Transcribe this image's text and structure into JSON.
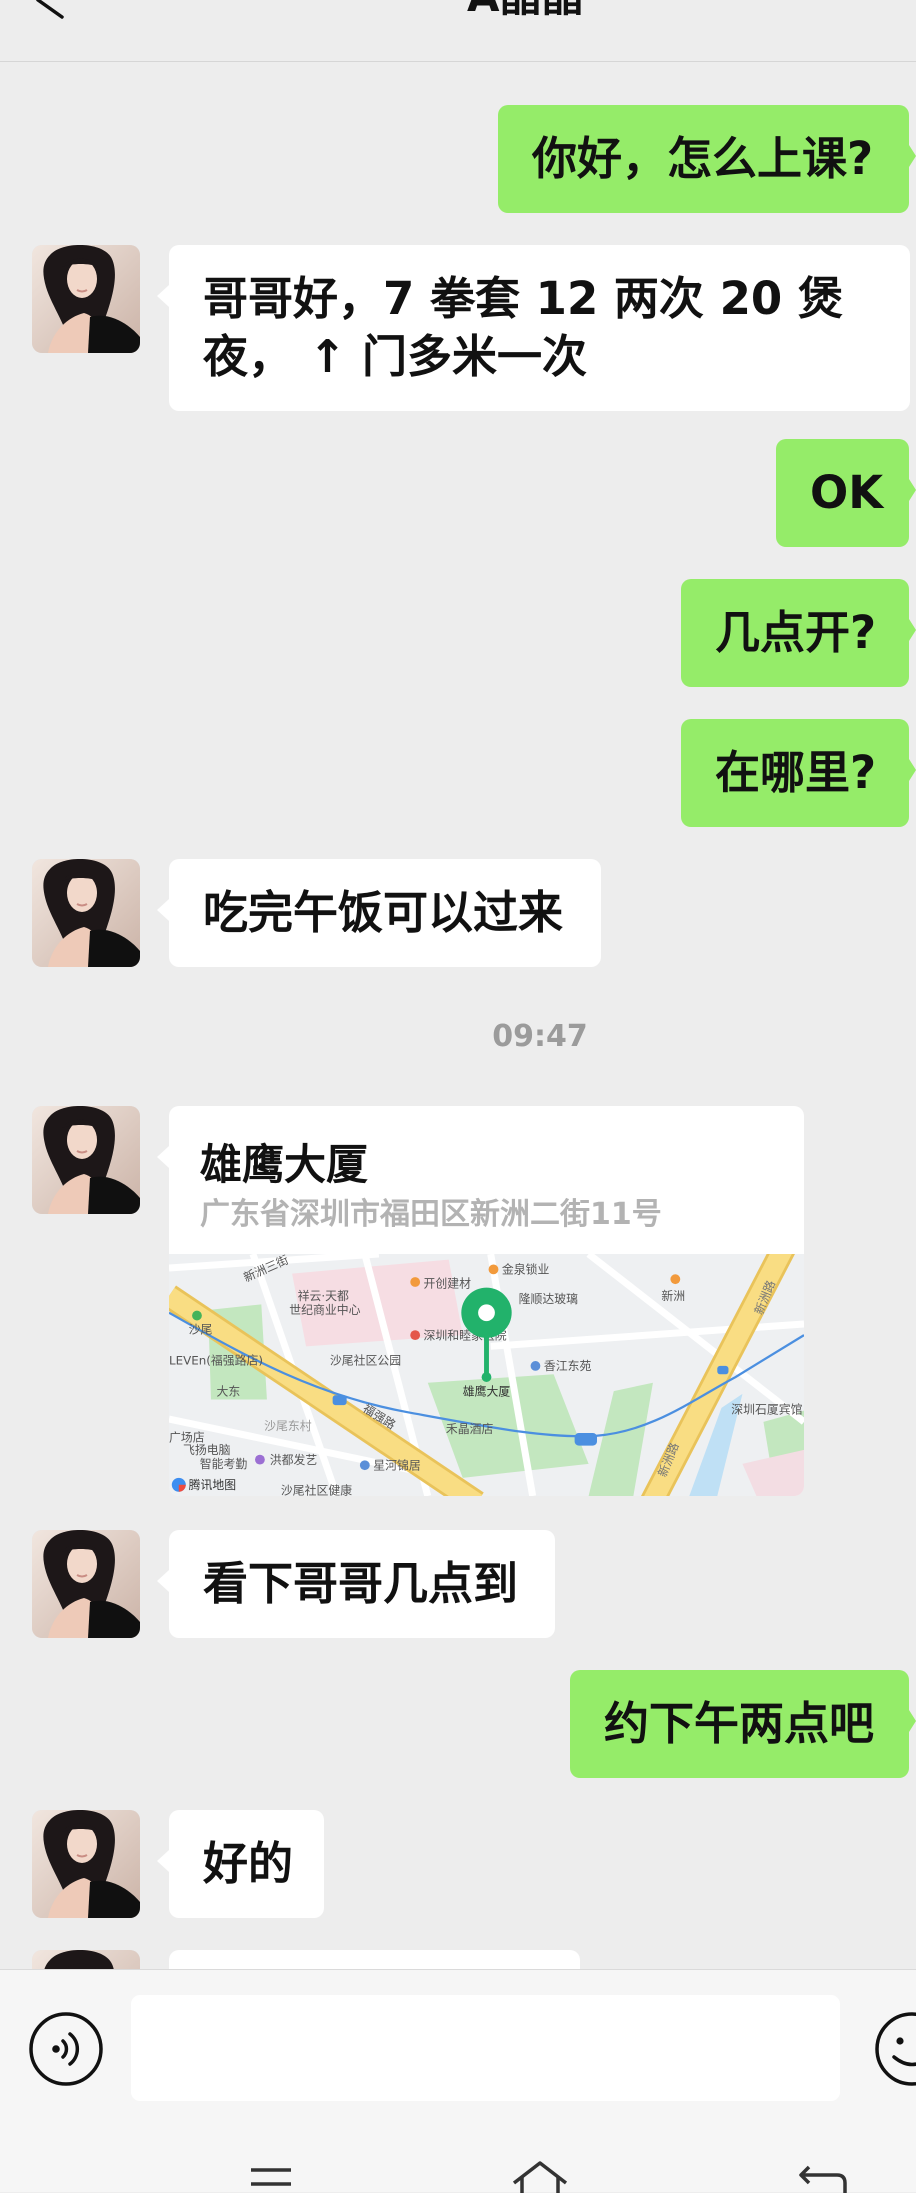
{
  "header": {
    "title": "A晶晶",
    "back_icon": "chevron-left-icon"
  },
  "colors": {
    "background": "#ededed",
    "bubble_me": "#95ec69",
    "bubble_contact": "#ffffff",
    "map_pin": "#22b26b",
    "timestamp": "#9b9b9b"
  },
  "contact": {
    "avatar": "avatar-photo"
  },
  "conversation": {
    "timestamp": "09:47",
    "messages": [
      {
        "from": "me",
        "text": "你好，怎么上课?"
      },
      {
        "from": "contact",
        "text": "哥哥好，7 拳套  12  两次   20 煲夜，   ↑ 门多米一次"
      },
      {
        "from": "me",
        "text": "OK"
      },
      {
        "from": "me",
        "text": "几点开?"
      },
      {
        "from": "me",
        "text": "在哪里?"
      },
      {
        "from": "contact",
        "text": "吃完午饭可以过来"
      },
      {
        "from": "contact",
        "type": "location",
        "name": "雄鹰大厦",
        "address": "广东省深圳市福田区新洲二街11号",
        "map_brand": "腾讯地图",
        "map_labels": [
          "金泉锁业",
          "开创建材",
          "新洲",
          "新洲三街",
          "祥云·天都",
          "世纪商业中心",
          "深圳和睦家医院",
          "隆顺达玻璃",
          "香江东苑",
          "沙尾社区公园",
          "福强路",
          "雄鹰大厦",
          "禾晶酒店",
          "沙尾东村",
          "新洲路",
          "深圳石厦宾馆",
          "飞扬电脑",
          "智能考勤",
          "洪都发艺",
          "星河锦居",
          "大东",
          "沙尾",
          "广场店",
          "LEVEn(福强路店)",
          "沙尾社区健康",
          "新洲路"
        ]
      },
      {
        "from": "contact",
        "text": "看下哥哥几点到"
      },
      {
        "from": "me",
        "text": "约下午两点吧"
      },
      {
        "from": "contact",
        "text": "好的"
      },
      {
        "from": "contact",
        "partial": true
      }
    ]
  },
  "input_bar": {
    "value": "",
    "voice_icon": "voice-icon",
    "emoji_icon": "emoji-icon"
  },
  "navigation_bar": {
    "icons": [
      "menu-icon",
      "home-icon",
      "back-icon"
    ]
  }
}
